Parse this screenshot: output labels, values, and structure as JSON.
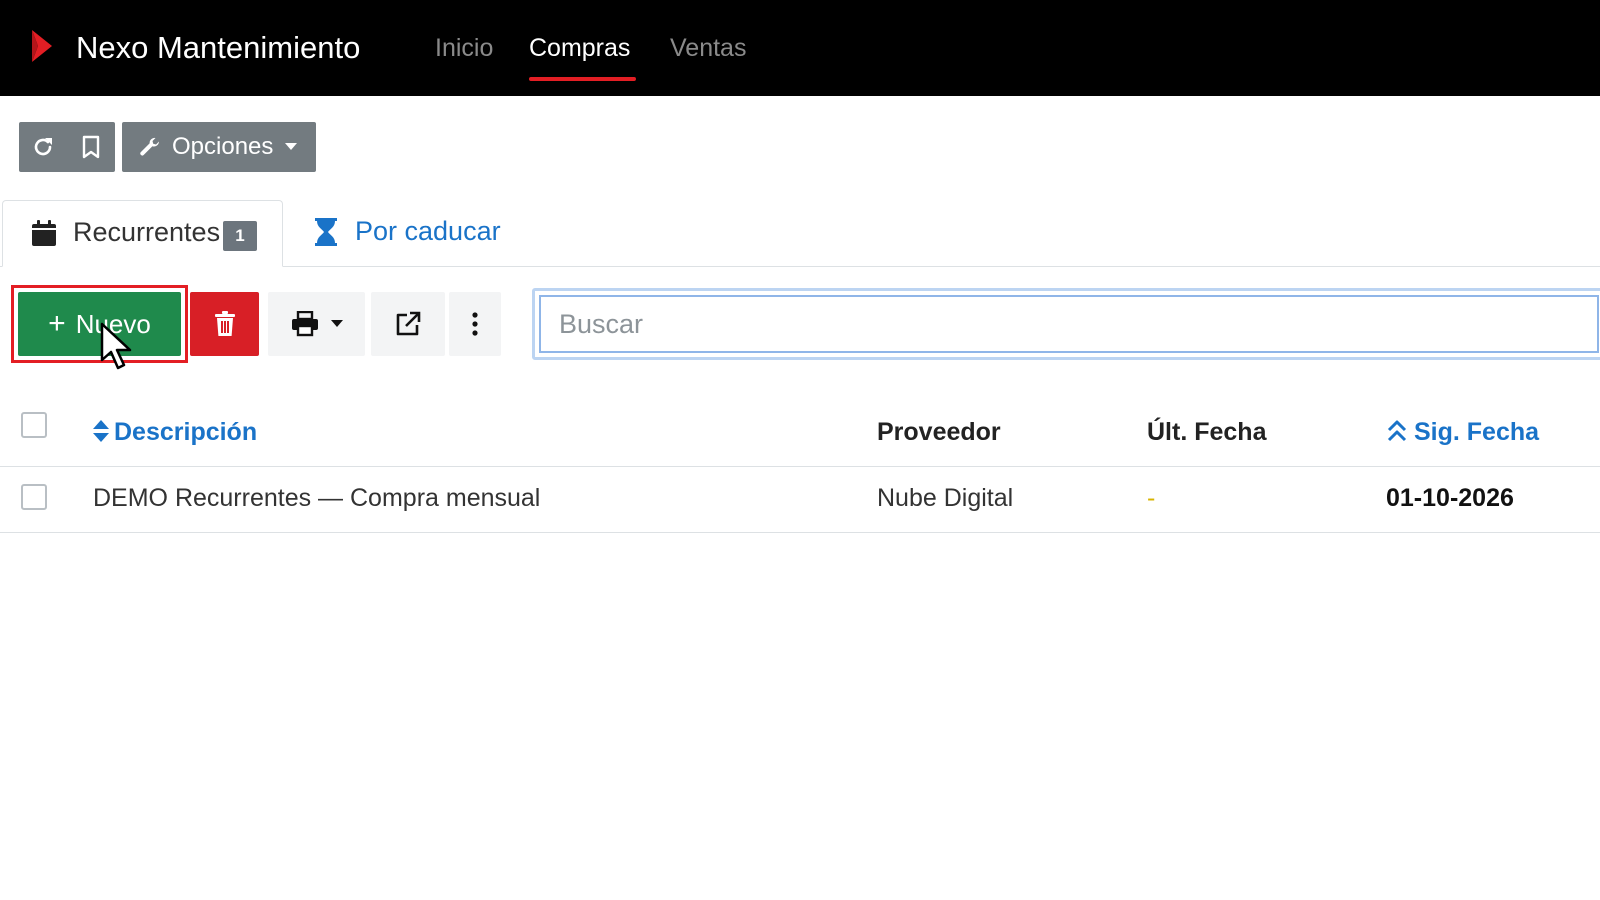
{
  "app": {
    "name": "Nexo Mantenimiento",
    "nav": [
      {
        "label": "Inicio",
        "active": false
      },
      {
        "label": "Compras",
        "active": true
      },
      {
        "label": "Ventas",
        "active": false
      }
    ],
    "accent_color": "#e31e24"
  },
  "toolbar": {
    "refresh_icon": "refresh-icon",
    "bookmark_icon": "bookmark-icon",
    "options_label": "Opciones"
  },
  "tabs": [
    {
      "label": "Recurrentes",
      "badge": "1",
      "icon": "calendar-icon",
      "active": true
    },
    {
      "label": "Por caducar",
      "icon": "hourglass-icon",
      "active": false
    }
  ],
  "actions": {
    "new_label": "Nuevo",
    "new_color": "#1f8a4c",
    "delete_color": "#d81f26",
    "search_placeholder": "Buscar"
  },
  "table": {
    "columns": [
      {
        "label": "Descripción",
        "sortable": true
      },
      {
        "label": "Proveedor",
        "sortable": false
      },
      {
        "label": "Últ. Fecha",
        "sortable": false
      },
      {
        "label": "Sig. Fecha",
        "sortable": true
      }
    ],
    "rows": [
      {
        "descripcion": "DEMO Recurrentes — Compra mensual",
        "proveedor": "Nube Digital",
        "ult_fecha": "-",
        "sig_fecha": "01-10-2026"
      }
    ]
  }
}
